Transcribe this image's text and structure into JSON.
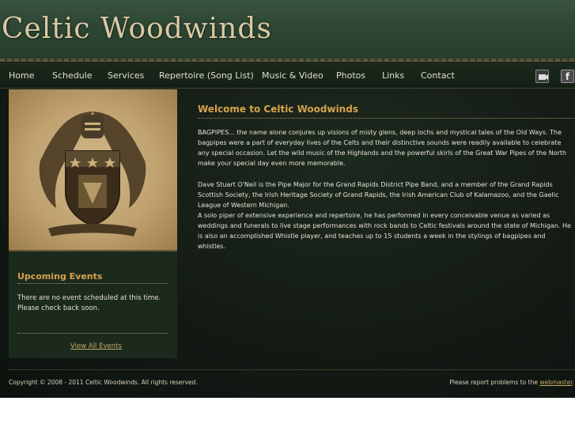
{
  "header": {
    "site_title": "Celtic Woodwinds"
  },
  "nav": {
    "items": [
      "Home",
      "Schedule",
      "Services",
      "Repertoire (Song List)",
      "Music & Video",
      "Photos",
      "Links",
      "Contact"
    ]
  },
  "social": {
    "icons": [
      "video-icon",
      "facebook-icon"
    ],
    "facebook_glyph": "f"
  },
  "sidebar": {
    "events_title": "Upcoming Events",
    "events_text": "There are no event scheduled at this time. Please check back soon.",
    "view_all": "View All Events"
  },
  "main": {
    "title": "Welcome to Celtic Woodwinds",
    "paragraphs": [
      "BAGPIPES... the name alone conjures up visions of misty glens, deep lochs and mystical tales of the Old Ways. The bagpipes were a part of everyday lives of the Celts and their distinctive sounds were readily available to celebrate any special occasion. Let the wild music of the Highlands and the powerful skirls of the Great War Pipes of the North make your special day even more memorable.",
      "Dave Stuart O'Neil is the Pipe Major for the Grand Rapids District Pipe Band, and a member of the Grand Rapids Scottish Society, the Irish Heritage Society of Grand Rapids, the Irish American Club of Kalamazoo, and the Gaelic League of Western Michigan.",
      "A solo piper of extensive experience and repertoire, he has performed in every conceivable venue as varied as weddings and funerals to live stage performances with rock bands to Celtic festivals around the state of Michigan. He is also an accomplished Whistle player, and teaches up to 15 students a week in the stylings of bagpipes and whistles."
    ]
  },
  "footer": {
    "copyright": "Copyright © 2008 - 2011 Celtic Woodwinds. All rights reserved.",
    "report_prefix": "Please report problems to the ",
    "report_link": "webmaster",
    "report_suffix": "."
  },
  "colors": {
    "accent": "#d6a34a",
    "link": "#c9a86a",
    "header_green": "#2e4734",
    "background": "#131a14"
  }
}
